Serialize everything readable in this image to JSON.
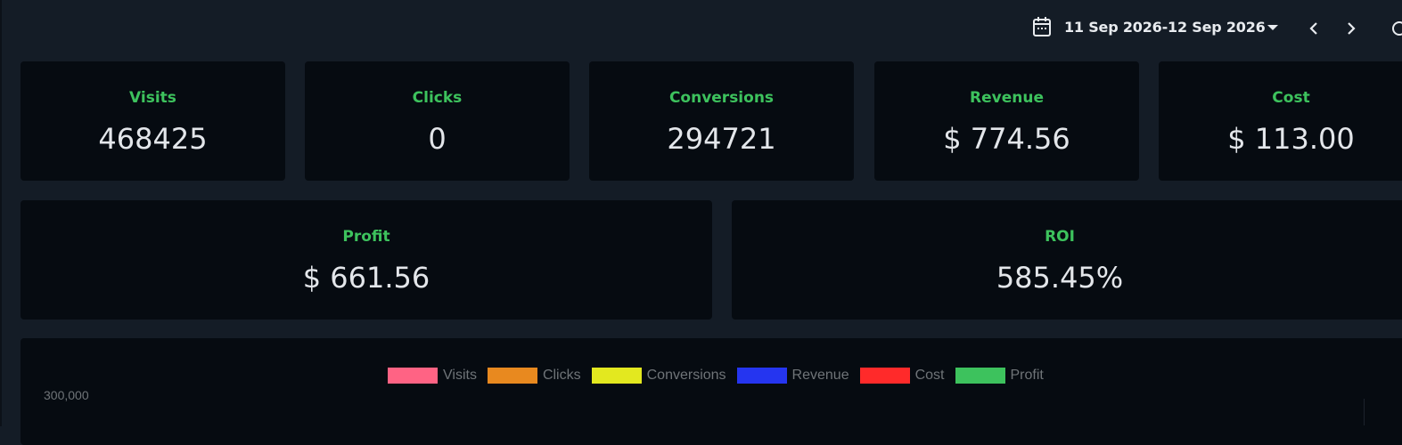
{
  "header": {
    "date_range": "11 Sep 2026-12 Sep 2026",
    "icons": [
      "calendar-icon",
      "caret-down-icon",
      "chevron-left-icon",
      "chevron-right-icon"
    ]
  },
  "metrics": {
    "visits": {
      "label": "Visits",
      "value": "468425"
    },
    "clicks": {
      "label": "Clicks",
      "value": "0"
    },
    "conversions": {
      "label": "Conversions",
      "value": "294721"
    },
    "revenue": {
      "label": "Revenue",
      "value": "$ 774.56"
    },
    "cost": {
      "label": "Cost",
      "value": "$ 113.00"
    },
    "profit": {
      "label": "Profit",
      "value": "$ 661.56"
    },
    "roi": {
      "label": "ROI",
      "value": "585.45%"
    }
  },
  "chart": {
    "legend": [
      {
        "name": "Visits",
        "color": "#ff6384"
      },
      {
        "name": "Clicks",
        "color": "#e8891f"
      },
      {
        "name": "Conversions",
        "color": "#e3e81f"
      },
      {
        "name": "Revenue",
        "color": "#2535f0"
      },
      {
        "name": "Cost",
        "color": "#ff2a2a"
      },
      {
        "name": "Profit",
        "color": "#3dc25d"
      }
    ],
    "y_tick_top": "300,000"
  },
  "colors": {
    "accent_label": "#3dc25d",
    "background": "#141c26",
    "card": "#060b11"
  }
}
